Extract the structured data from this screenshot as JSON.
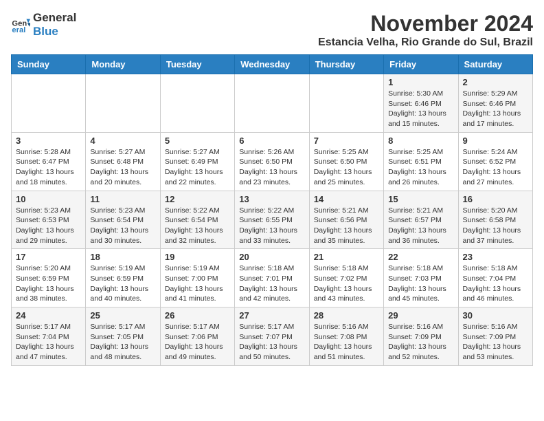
{
  "logo": {
    "line1": "General",
    "line2": "Blue"
  },
  "header": {
    "month": "November 2024",
    "location": "Estancia Velha, Rio Grande do Sul, Brazil"
  },
  "weekdays": [
    "Sunday",
    "Monday",
    "Tuesday",
    "Wednesday",
    "Thursday",
    "Friday",
    "Saturday"
  ],
  "weeks": [
    [
      {
        "day": "",
        "info": ""
      },
      {
        "day": "",
        "info": ""
      },
      {
        "day": "",
        "info": ""
      },
      {
        "day": "",
        "info": ""
      },
      {
        "day": "",
        "info": ""
      },
      {
        "day": "1",
        "info": "Sunrise: 5:30 AM\nSunset: 6:46 PM\nDaylight: 13 hours and 15 minutes."
      },
      {
        "day": "2",
        "info": "Sunrise: 5:29 AM\nSunset: 6:46 PM\nDaylight: 13 hours and 17 minutes."
      }
    ],
    [
      {
        "day": "3",
        "info": "Sunrise: 5:28 AM\nSunset: 6:47 PM\nDaylight: 13 hours and 18 minutes."
      },
      {
        "day": "4",
        "info": "Sunrise: 5:27 AM\nSunset: 6:48 PM\nDaylight: 13 hours and 20 minutes."
      },
      {
        "day": "5",
        "info": "Sunrise: 5:27 AM\nSunset: 6:49 PM\nDaylight: 13 hours and 22 minutes."
      },
      {
        "day": "6",
        "info": "Sunrise: 5:26 AM\nSunset: 6:50 PM\nDaylight: 13 hours and 23 minutes."
      },
      {
        "day": "7",
        "info": "Sunrise: 5:25 AM\nSunset: 6:50 PM\nDaylight: 13 hours and 25 minutes."
      },
      {
        "day": "8",
        "info": "Sunrise: 5:25 AM\nSunset: 6:51 PM\nDaylight: 13 hours and 26 minutes."
      },
      {
        "day": "9",
        "info": "Sunrise: 5:24 AM\nSunset: 6:52 PM\nDaylight: 13 hours and 27 minutes."
      }
    ],
    [
      {
        "day": "10",
        "info": "Sunrise: 5:23 AM\nSunset: 6:53 PM\nDaylight: 13 hours and 29 minutes."
      },
      {
        "day": "11",
        "info": "Sunrise: 5:23 AM\nSunset: 6:54 PM\nDaylight: 13 hours and 30 minutes."
      },
      {
        "day": "12",
        "info": "Sunrise: 5:22 AM\nSunset: 6:54 PM\nDaylight: 13 hours and 32 minutes."
      },
      {
        "day": "13",
        "info": "Sunrise: 5:22 AM\nSunset: 6:55 PM\nDaylight: 13 hours and 33 minutes."
      },
      {
        "day": "14",
        "info": "Sunrise: 5:21 AM\nSunset: 6:56 PM\nDaylight: 13 hours and 35 minutes."
      },
      {
        "day": "15",
        "info": "Sunrise: 5:21 AM\nSunset: 6:57 PM\nDaylight: 13 hours and 36 minutes."
      },
      {
        "day": "16",
        "info": "Sunrise: 5:20 AM\nSunset: 6:58 PM\nDaylight: 13 hours and 37 minutes."
      }
    ],
    [
      {
        "day": "17",
        "info": "Sunrise: 5:20 AM\nSunset: 6:59 PM\nDaylight: 13 hours and 38 minutes."
      },
      {
        "day": "18",
        "info": "Sunrise: 5:19 AM\nSunset: 6:59 PM\nDaylight: 13 hours and 40 minutes."
      },
      {
        "day": "19",
        "info": "Sunrise: 5:19 AM\nSunset: 7:00 PM\nDaylight: 13 hours and 41 minutes."
      },
      {
        "day": "20",
        "info": "Sunrise: 5:18 AM\nSunset: 7:01 PM\nDaylight: 13 hours and 42 minutes."
      },
      {
        "day": "21",
        "info": "Sunrise: 5:18 AM\nSunset: 7:02 PM\nDaylight: 13 hours and 43 minutes."
      },
      {
        "day": "22",
        "info": "Sunrise: 5:18 AM\nSunset: 7:03 PM\nDaylight: 13 hours and 45 minutes."
      },
      {
        "day": "23",
        "info": "Sunrise: 5:18 AM\nSunset: 7:04 PM\nDaylight: 13 hours and 46 minutes."
      }
    ],
    [
      {
        "day": "24",
        "info": "Sunrise: 5:17 AM\nSunset: 7:04 PM\nDaylight: 13 hours and 47 minutes."
      },
      {
        "day": "25",
        "info": "Sunrise: 5:17 AM\nSunset: 7:05 PM\nDaylight: 13 hours and 48 minutes."
      },
      {
        "day": "26",
        "info": "Sunrise: 5:17 AM\nSunset: 7:06 PM\nDaylight: 13 hours and 49 minutes."
      },
      {
        "day": "27",
        "info": "Sunrise: 5:17 AM\nSunset: 7:07 PM\nDaylight: 13 hours and 50 minutes."
      },
      {
        "day": "28",
        "info": "Sunrise: 5:16 AM\nSunset: 7:08 PM\nDaylight: 13 hours and 51 minutes."
      },
      {
        "day": "29",
        "info": "Sunrise: 5:16 AM\nSunset: 7:09 PM\nDaylight: 13 hours and 52 minutes."
      },
      {
        "day": "30",
        "info": "Sunrise: 5:16 AM\nSunset: 7:09 PM\nDaylight: 13 hours and 53 minutes."
      }
    ]
  ]
}
